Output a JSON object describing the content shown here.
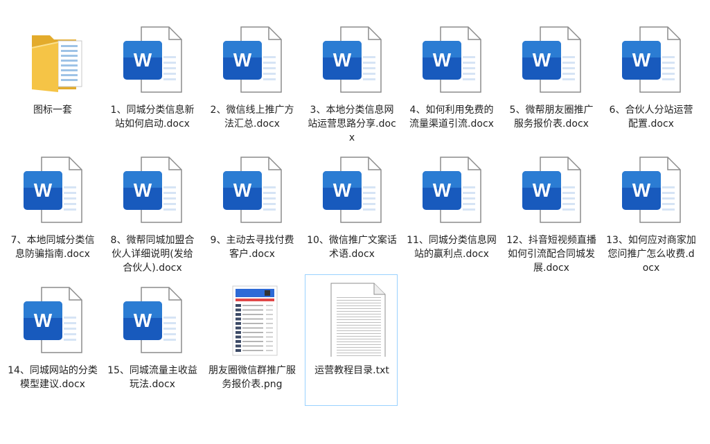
{
  "files": [
    {
      "name": "图标一套",
      "type": "folder"
    },
    {
      "name": "1、同城分类信息新站如何启动.docx",
      "type": "word"
    },
    {
      "name": "2、微信线上推广方法汇总.docx",
      "type": "word"
    },
    {
      "name": "3、本地分类信息网站运营思路分享.docx",
      "type": "word"
    },
    {
      "name": "4、如何利用免费的流量渠道引流.docx",
      "type": "word"
    },
    {
      "name": "5、微帮朋友圈推广服务报价表.docx",
      "type": "word"
    },
    {
      "name": "6、合伙人分站运营配置.docx",
      "type": "word"
    },
    {
      "name": "7、本地同城分类信息防骗指南.docx",
      "type": "word"
    },
    {
      "name": "8、微帮同城加盟合伙人详细说明(发给合伙人).docx",
      "type": "word"
    },
    {
      "name": "9、主动去寻找付费客户.docx",
      "type": "word"
    },
    {
      "name": "10、微信推广文案话术语.docx",
      "type": "word"
    },
    {
      "name": "11、同城分类信息网站的赢利点.docx",
      "type": "word"
    },
    {
      "name": "12、抖音短视频直播如何引流配合同城发展.docx",
      "type": "word"
    },
    {
      "name": "13、如何应对商家加您问推广怎么收费.docx",
      "type": "word"
    },
    {
      "name": "14、同城网站的分类模型建议.docx",
      "type": "word"
    },
    {
      "name": "15、同城流量主收益玩法.docx",
      "type": "word"
    },
    {
      "name": "朋友圈微信群推广服务报价表.png",
      "type": "image"
    },
    {
      "name": "运营教程目录.txt",
      "type": "text",
      "selected": true
    }
  ],
  "word_glyph": "W",
  "colors": {
    "word_blue": "#185abd",
    "word_blue_light": "#2b7cd3",
    "folder_yellow": "#f5c446",
    "selection_border": "#99d1ff"
  }
}
